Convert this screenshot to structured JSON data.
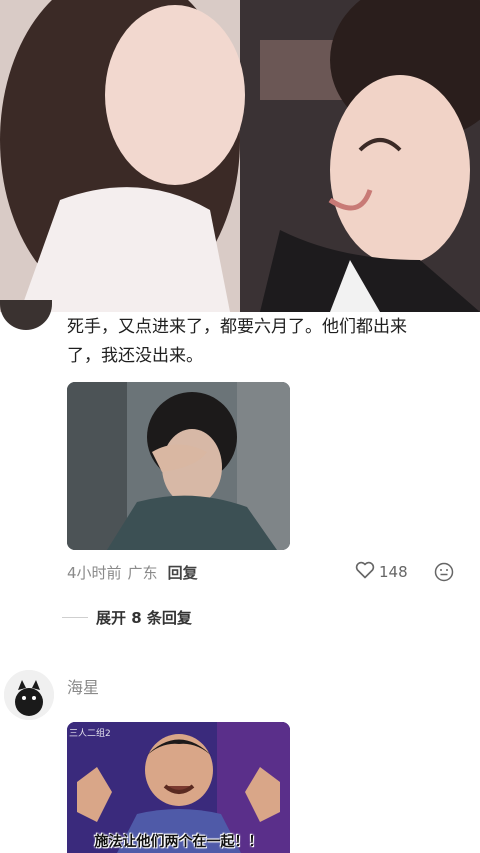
{
  "hero": {
    "icon": "drama-still-image"
  },
  "comment1": {
    "text_line1": "死手，又点进来了，都要六月了。他们都出来",
    "text_line2": "了，我还没出来。",
    "time": "4小时前",
    "location": "广东",
    "reply_label": "回复",
    "likes": "148",
    "expand_label": "展开 8 条回复"
  },
  "comment2": {
    "username": "海星",
    "image_logo": "三人二组2",
    "subtitle": "施法让他们两个在一起！！"
  },
  "colors": {
    "text": "#1f1f1f",
    "meta": "#8a8a8a",
    "divider": "#cfcfcf"
  }
}
